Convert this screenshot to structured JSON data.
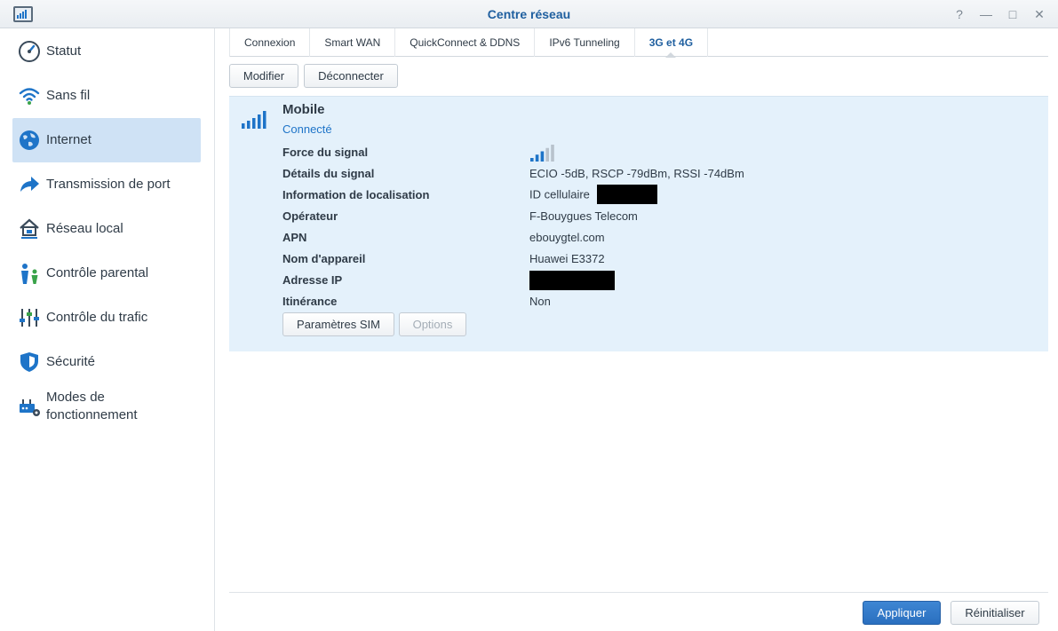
{
  "window": {
    "title": "Centre réseau",
    "controls": [
      "?",
      "—",
      "□",
      "✕"
    ]
  },
  "sidebar": {
    "items": [
      {
        "label": "Statut",
        "icon": "speedometer-icon"
      },
      {
        "label": "Sans fil",
        "icon": "wifi-icon"
      },
      {
        "label": "Internet",
        "icon": "globe-icon",
        "active": true
      },
      {
        "label": "Transmission de port",
        "icon": "forward-arrow-icon"
      },
      {
        "label": "Réseau local",
        "icon": "home-network-icon"
      },
      {
        "label": "Contrôle parental",
        "icon": "parent-child-icon"
      },
      {
        "label": "Contrôle du trafic",
        "icon": "sliders-icon"
      },
      {
        "label": "Sécurité",
        "icon": "shield-icon"
      },
      {
        "label": "Modes de fonctionnement",
        "line1": "Modes de",
        "line2": "fonctionnement",
        "icon": "router-gear-icon"
      }
    ]
  },
  "tabs": [
    {
      "label": "Connexion"
    },
    {
      "label": "Smart WAN"
    },
    {
      "label": "QuickConnect & DDNS"
    },
    {
      "label": "IPv6 Tunneling"
    },
    {
      "label": "3G et 4G",
      "active": true
    }
  ],
  "toolbar": {
    "modify_label": "Modifier",
    "disconnect_label": "Déconnecter"
  },
  "mobile": {
    "title": "Mobile",
    "status": "Connecté",
    "signal_bars_active": 3,
    "signal_bars_total": 5,
    "rows": {
      "signal_strength": {
        "label": "Force du signal"
      },
      "signal_details": {
        "label": "Détails du signal",
        "value": "ECIO -5dB, RSCP -79dBm, RSSI -74dBm"
      },
      "location": {
        "label": "Information de localisation",
        "value": "ID cellulaire"
      },
      "operator": {
        "label": "Opérateur",
        "value": "F-Bouygues Telecom"
      },
      "apn": {
        "label": "APN",
        "value": "ebouygtel.com"
      },
      "device_name": {
        "label": "Nom d'appareil",
        "value": "Huawei E3372"
      },
      "ip_address": {
        "label": "Adresse IP",
        "value": ""
      },
      "roaming": {
        "label": "Itinérance",
        "value": "Non"
      }
    },
    "sim_settings_label": "Paramètres SIM",
    "options_label": "Options"
  },
  "footer": {
    "apply_label": "Appliquer",
    "reset_label": "Réinitialiser"
  },
  "colors": {
    "accent": "#1e74c8",
    "active_sidebar": "#cfe2f5",
    "panel_bg": "#e4f1fb",
    "signal_active": "#1e74c8",
    "signal_inactive": "#b8c2cc"
  }
}
